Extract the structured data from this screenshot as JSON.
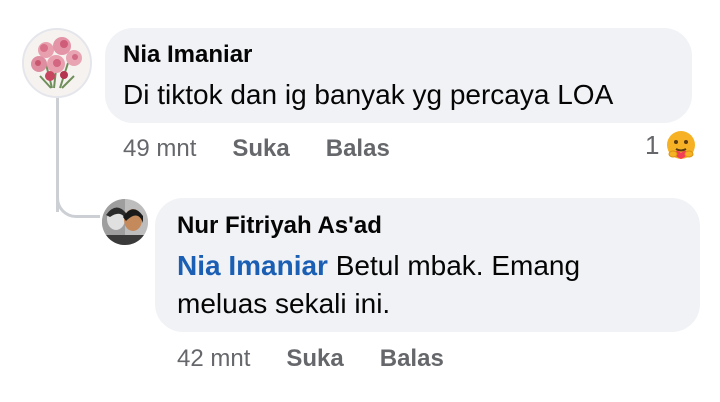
{
  "comment": {
    "author": "Nia Imaniar",
    "text": "Di tiktok dan ig banyak yg percaya LOA",
    "time": "49 mnt",
    "like_label": "Suka",
    "reply_label": "Balas",
    "reaction_count": "1",
    "reaction_icon": "care-emoji-icon",
    "avatar_icon": "carnation-flowers-avatar"
  },
  "reply": {
    "author": "Nur Fitriyah As'ad",
    "mention": "Nia Imaniar",
    "text_line1": " Betul mbak. Emang",
    "text_line2": "meluas sekali ini.",
    "time": "42 mnt",
    "like_label": "Suka",
    "reply_label": "Balas",
    "avatar_icon": "two-people-avatar"
  },
  "colors": {
    "bubble": "#f0f2f5",
    "mention": "#1a5fb4",
    "meta_text": "#65676b",
    "thread_line": "#ccd0d5"
  }
}
